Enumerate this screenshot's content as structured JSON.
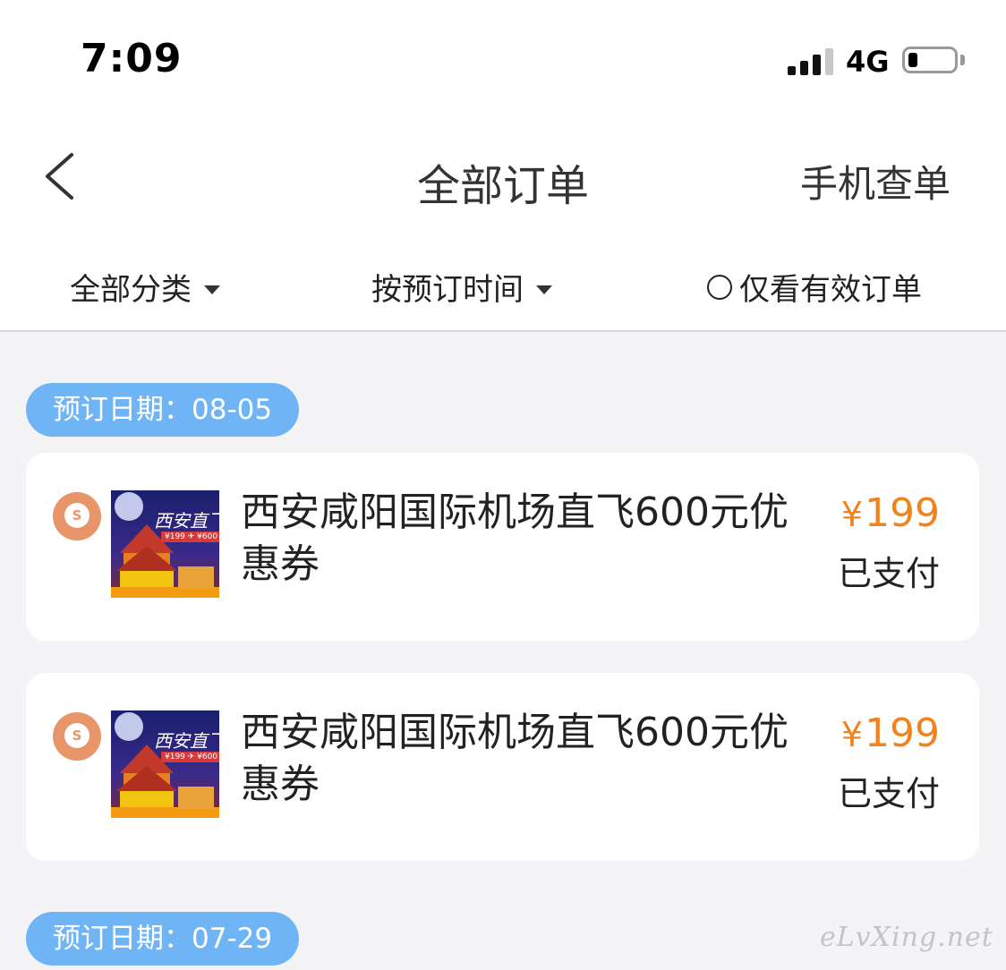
{
  "status_bar": {
    "time": "7:09",
    "network": "4G",
    "battery_level": 0.2
  },
  "nav": {
    "title": "全部订单",
    "right_action": "手机查单"
  },
  "filters": {
    "category": "全部分类",
    "sort": "按预订时间",
    "valid_only": "仅看有效订单"
  },
  "groups": [
    {
      "date_label": "预订日期：08-05",
      "orders": [
        {
          "name": "西安咸阳国际机场直飞600元优惠券",
          "price": "199",
          "currency": "¥",
          "status": "已支付",
          "thumb_caption": "西安直飞",
          "thumb_tag": "¥199 ✈ ¥600"
        },
        {
          "name": "西安咸阳国际机场直飞600元优惠券",
          "price": "199",
          "currency": "¥",
          "status": "已支付",
          "thumb_caption": "西安直飞",
          "thumb_tag": "¥199 ✈ ¥600"
        }
      ]
    },
    {
      "date_label": "预订日期：07-29",
      "orders": []
    }
  ],
  "watermark": "eLvXing.net",
  "colors": {
    "accent_blue": "#6fb5f5",
    "price_orange": "#f08320",
    "badge_orange": "#e8956a"
  },
  "icons": {
    "back": "chevron-left-icon",
    "caret": "caret-down-icon",
    "radio": "radio-unchecked-icon",
    "badge": "coupon-badge-icon"
  }
}
